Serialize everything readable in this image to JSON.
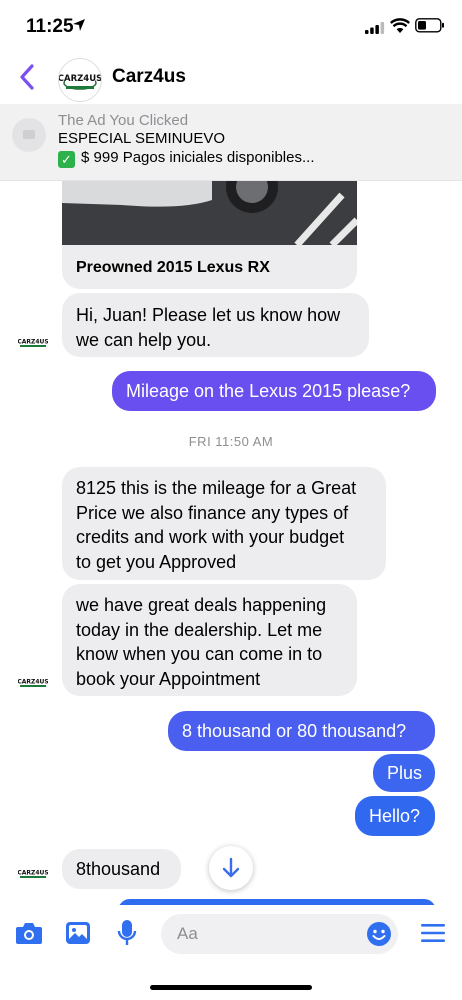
{
  "status": {
    "time": "11:25"
  },
  "header": {
    "title": "Carz4us",
    "logo_text": "CARZ4US"
  },
  "ad": {
    "label": "The Ad You Clicked",
    "line1": "ESPECIAL SEMINUEVO",
    "line2": "$ 999 Pagos iniciales disponibles..."
  },
  "card": {
    "title": "Preowned 2015 Lexus RX"
  },
  "messages": [
    {
      "text": "Hi, Juan! Please let us know how\nwe can help you."
    },
    {
      "text": "Mileage on the Lexus 2015 please?"
    },
    {
      "text": "FRI 11:50 AM"
    },
    {
      "text": "8125 this is the mileage for a Great\nPrice we also finance any types of\ncredits and work with your budget\nto get you Approved"
    },
    {
      "text": "we have great deals happening\ntoday in the dealership. Let me\nknow when you can come in to\nbook your Appointment"
    },
    {
      "text": "8 thousand or 80 thousand?"
    },
    {
      "text": "Plus"
    },
    {
      "text": "Hello?"
    },
    {
      "text": "8thousand"
    }
  ],
  "composer": {
    "placeholder": "Aa"
  },
  "colors": {
    "accent": "#4c5ef0",
    "incoming": "#ededef",
    "purple_top": "#6a4ff0",
    "blue_bottom": "#2f6df0"
  }
}
